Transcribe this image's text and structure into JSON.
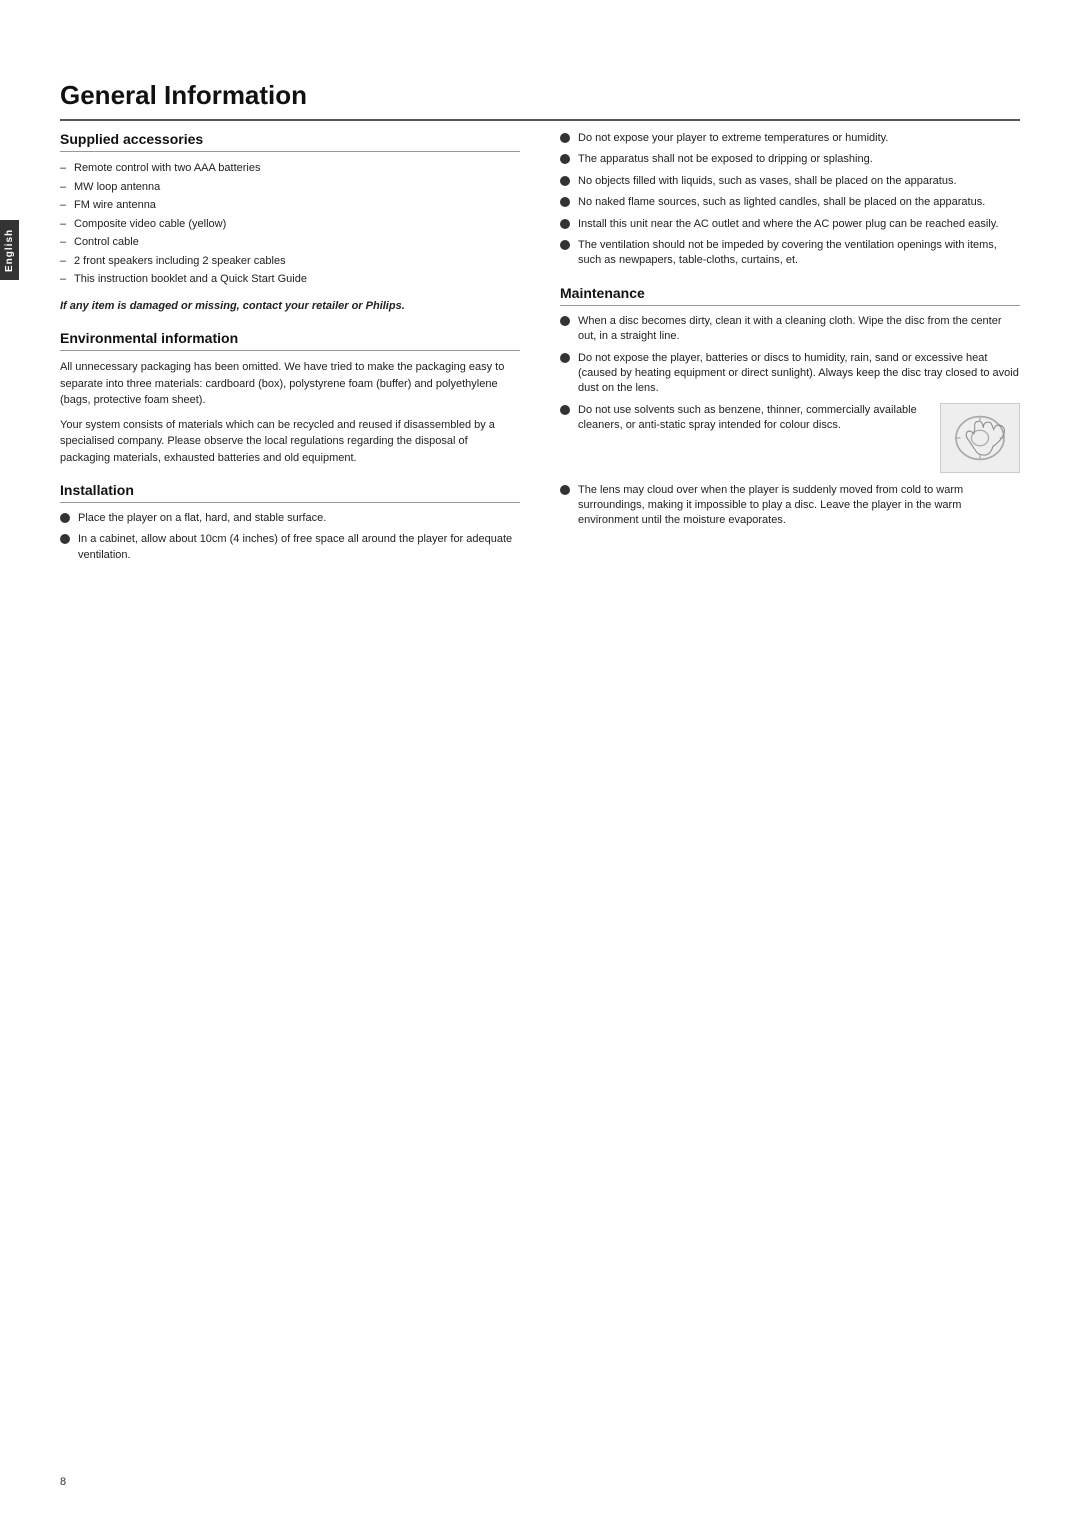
{
  "page": {
    "title": "General Information",
    "page_number": "8",
    "sidebar_label": "English"
  },
  "supplied_accessories": {
    "section_title": "Supplied accessories",
    "items": [
      "Remote control with two AAA batteries",
      "MW loop antenna",
      "FM wire antenna",
      "Composite video cable (yellow)",
      "Control cable",
      "2 front speakers including 2 speaker cables",
      "This instruction booklet and a Quick Start Guide"
    ],
    "missing_notice": "If any item is damaged or missing, contact your retailer or Philips."
  },
  "environmental": {
    "section_title": "Environmental information",
    "paragraphs": [
      "All unnecessary packaging has been omitted. We have tried to make the packaging easy to separate into three materials: cardboard (box), polystyrene foam (buffer) and polyethylene (bags, protective foam sheet).",
      "Your system consists of materials which can be recycled and reused if disassembled by a specialised company. Please observe the local regulations regarding the disposal of packaging materials, exhausted batteries and old equipment."
    ]
  },
  "installation": {
    "section_title": "Installation",
    "items": [
      "Place the player on a flat, hard, and stable surface.",
      "In a cabinet, allow about 10cm (4 inches) of free space all around the player for adequate ventilation."
    ]
  },
  "right_bullets_top": {
    "items": [
      "Do not expose your player to extreme temperatures or humidity.",
      "The apparatus shall not be exposed to dripping or splashing.",
      "No objects  filled with liquids, such as vases, shall be placed on the apparatus.",
      "No naked flame sources, such as lighted candles, shall be placed on the apparatus.",
      "Install this unit near the AC outlet and where the AC power plug can be reached easily.",
      "The ventilation should not be impeded by covering the ventilation openings with items, such as newpapers, table-cloths, curtains, et."
    ]
  },
  "maintenance": {
    "section_title": "Maintenance",
    "items": [
      "When a disc becomes dirty, clean it with a cleaning cloth. Wipe the disc from the center out, in a straight line.",
      "Do not expose the player, batteries or discs to humidity, rain, sand or excessive heat (caused by heating equipment or direct sunlight). Always keep the disc tray closed to avoid dust on the lens.",
      "Do not use solvents such as benzene, thinner, commercially available cleaners, or anti-static spray intended for colour discs.",
      "The lens may cloud over when the player is suddenly moved from cold to warm surroundings, making it impossible to play a disc. Leave the player in the warm environment until the moisture evaporates."
    ]
  }
}
